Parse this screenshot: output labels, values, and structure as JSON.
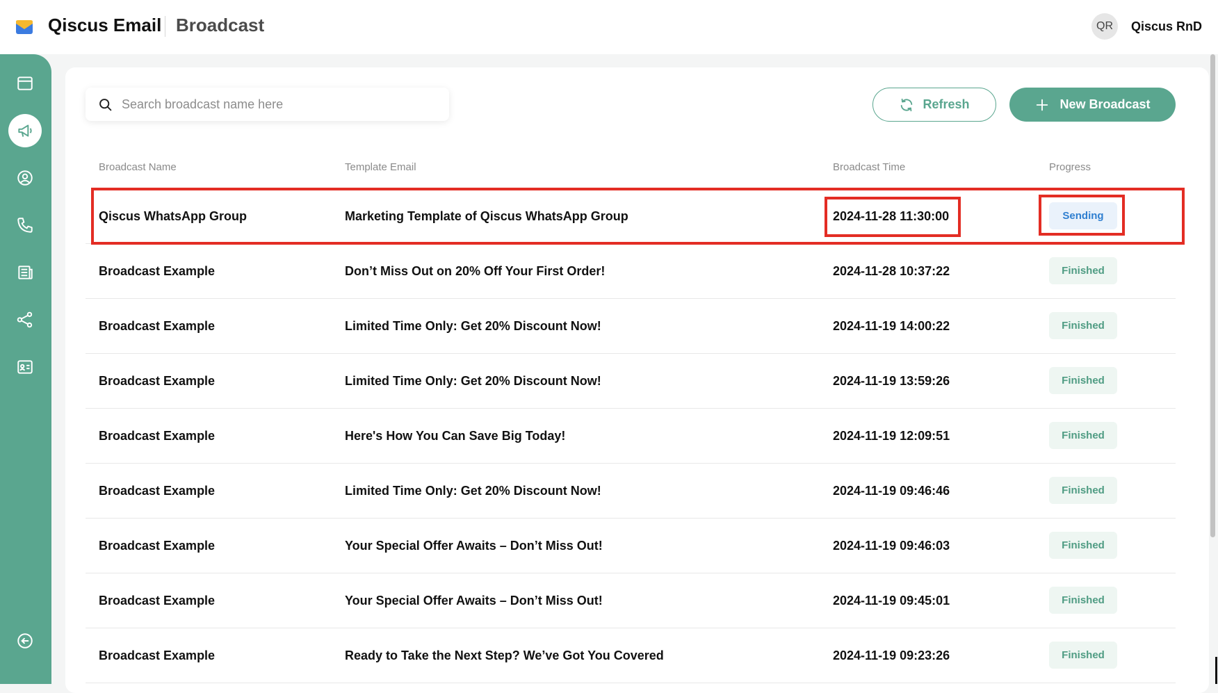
{
  "header": {
    "app_title": "Qiscus Email",
    "page_title": "Broadcast",
    "avatar_initials": "QR",
    "user_name": "Qiscus RnD"
  },
  "sidebar": {
    "items": [
      {
        "icon": "window-icon",
        "active": false
      },
      {
        "icon": "megaphone-icon",
        "active": true
      },
      {
        "icon": "user-circle-icon",
        "active": false
      },
      {
        "icon": "phone-icon",
        "active": false
      },
      {
        "icon": "newspaper-icon",
        "active": false
      },
      {
        "icon": "share-nodes-icon",
        "active": false
      },
      {
        "icon": "contact-card-icon",
        "active": false
      },
      {
        "icon": "collapse-arrow-icon",
        "active": false
      }
    ]
  },
  "search": {
    "placeholder": "Search broadcast name here",
    "value": ""
  },
  "actions": {
    "refresh_label": "Refresh",
    "new_label": "New Broadcast"
  },
  "table": {
    "headers": {
      "name": "Broadcast Name",
      "template": "Template Email",
      "time": "Broadcast Time",
      "progress": "Progress"
    },
    "rows": [
      {
        "name": "Qiscus WhatsApp Group",
        "template": "Marketing Template of Qiscus WhatsApp Group",
        "time": "2024-11-28 11:30:00",
        "progress": "Sending"
      },
      {
        "name": "Broadcast Example",
        "template": "Don’t Miss Out on 20% Off Your First Order!",
        "time": "2024-11-28 10:37:22",
        "progress": "Finished"
      },
      {
        "name": "Broadcast Example",
        "template": "Limited Time Only: Get 20% Discount Now!",
        "time": "2024-11-19 14:00:22",
        "progress": "Finished"
      },
      {
        "name": "Broadcast Example",
        "template": "Limited Time Only: Get 20% Discount Now!",
        "time": "2024-11-19 13:59:26",
        "progress": "Finished"
      },
      {
        "name": "Broadcast Example",
        "template": "Here's How You Can Save Big Today!",
        "time": "2024-11-19 12:09:51",
        "progress": "Finished"
      },
      {
        "name": "Broadcast Example",
        "template": "Limited Time Only: Get 20% Discount Now!",
        "time": "2024-11-19 09:46:46",
        "progress": "Finished"
      },
      {
        "name": "Broadcast Example",
        "template": "Your Special Offer Awaits – Don’t Miss Out!",
        "time": "2024-11-19 09:46:03",
        "progress": "Finished"
      },
      {
        "name": "Broadcast Example",
        "template": "Your Special Offer Awaits – Don’t Miss Out!",
        "time": "2024-11-19 09:45:01",
        "progress": "Finished"
      },
      {
        "name": "Broadcast Example",
        "template": "Ready to Take the Next Step? We’ve Got You Covered",
        "time": "2024-11-19 09:23:26",
        "progress": "Finished"
      }
    ]
  },
  "colors": {
    "accent": "#5aa68f",
    "highlight": "#e32d24",
    "sending": "#2f7fd0"
  }
}
